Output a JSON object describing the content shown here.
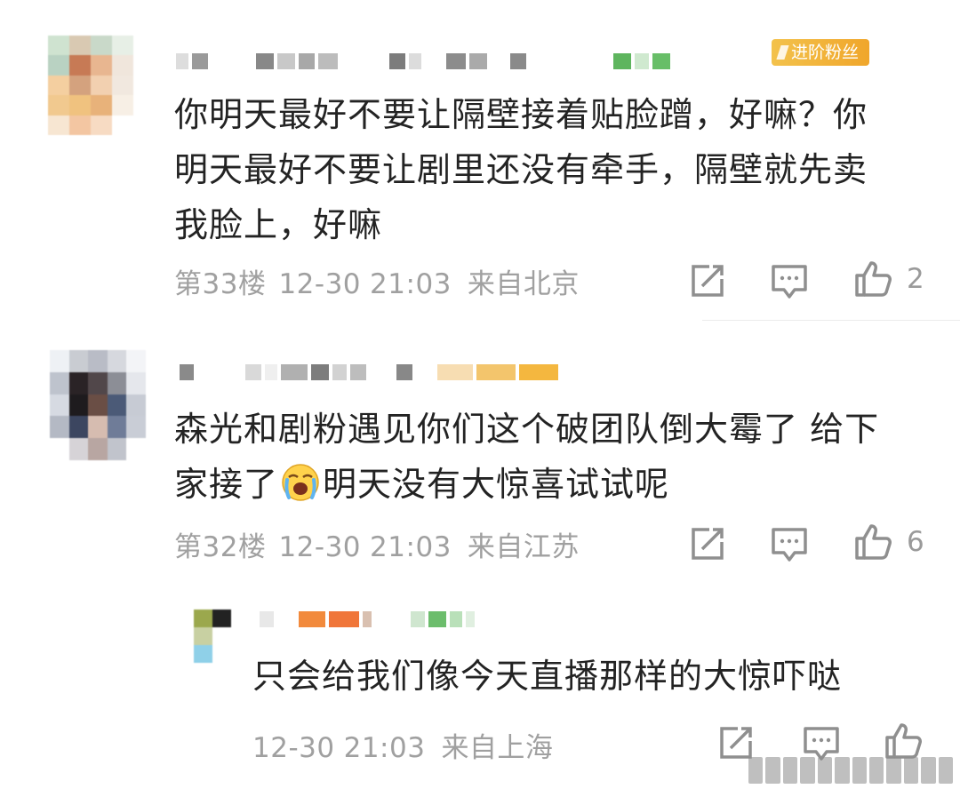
{
  "comments": [
    {
      "badge": "进阶粉丝",
      "text_lines": [
        "你明天最好不要让隔壁接着贴脸蹭，好嘛？你",
        "明天最好不要让剧里还没有牵手，隔壁就先卖",
        "我脸上，好嘛"
      ],
      "floor": "第33楼",
      "date": "12-30",
      "time": "21:03",
      "location": "来自北京",
      "like_count": "2",
      "icons": [
        "share-icon",
        "comment-icon",
        "like-icon"
      ]
    },
    {
      "text_line1": "森光和剧粉遇见你们这个破团队倒大霉了 给下",
      "text_line2_a": "家接了",
      "emoji": "crying-emoji",
      "text_line2_b": "明天没有大惊喜试试呢",
      "floor": "第32楼",
      "date": "12-30",
      "time": "21:03",
      "location": "来自江苏",
      "like_count": "6",
      "icons": [
        "share-icon",
        "comment-icon",
        "like-icon"
      ]
    },
    {
      "text": "只会给我们像今天直播那样的大惊吓哒",
      "date": "12-30",
      "time": "21:03",
      "location": "来自上海",
      "icons": [
        "share-icon",
        "comment-icon",
        "like-icon"
      ]
    }
  ],
  "colors": {
    "text": "#232323",
    "meta": "#a0a0a0",
    "badge": "#f0a62b",
    "icon": "#8f8f8f"
  }
}
